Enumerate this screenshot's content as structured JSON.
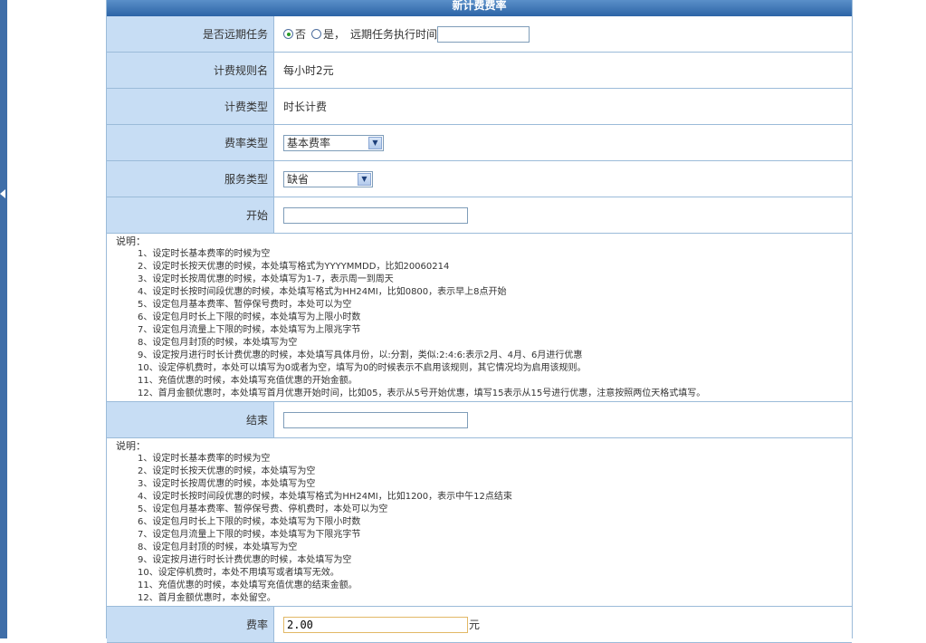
{
  "window": {
    "title": "新计费费率"
  },
  "form": {
    "future_task": {
      "label": "是否远期任务",
      "option_no": "否",
      "option_yes": "是，",
      "exec_time_label": "远期任务执行时间",
      "exec_time_value": ""
    },
    "rule_name": {
      "label": "计费规则名",
      "value": "每小时2元"
    },
    "charge_type": {
      "label": "计费类型",
      "value": "时长计费"
    },
    "rate_type": {
      "label": "费率类型",
      "selected": "基本费率"
    },
    "service_type": {
      "label": "服务类型",
      "selected": "缺省"
    },
    "start": {
      "label": "开始",
      "value": ""
    },
    "end": {
      "label": "结束",
      "value": ""
    },
    "rate": {
      "label": "费率",
      "value": "2.00",
      "unit": "元"
    }
  },
  "start_notes": {
    "heading": "说明：",
    "items": [
      "1、设定时长基本费率的时候为空",
      "2、设定时长按天优惠的时候，本处填写格式为YYYYMMDD，比如20060214",
      "3、设定时长按周优惠的时候，本处填写为1-7，表示周一到周天",
      "4、设定时长按时间段优惠的时候，本处填写格式为HH24MI，比如0800，表示早上8点开始",
      "5、设定包月基本费率、暂停保号费时，本处可以为空",
      "6、设定包月时长上下限的时候，本处填写为上限小时数",
      "7、设定包月流量上下限的时候，本处填写为上限兆字节",
      "8、设定包月封顶的时候，本处填写为空",
      "9、设定按月进行时长计费优惠的时候，本处填写具体月份，以:分割，类似:2:4:6:表示2月、4月、6月进行优惠",
      "10、设定停机费时，本处可以填写为0或者为空，填写为0的时候表示不启用该规则，其它情况均为启用该规则。",
      "11、充值优惠的时候，本处填写充值优惠的开始金额。",
      "12、首月金额优惠时，本处填写首月优惠开始时间，比如05，表示从5号开始优惠，填写15表示从15号进行优惠，注意按照两位天格式填写。"
    ]
  },
  "end_notes": {
    "heading": "说明：",
    "items": [
      "1、设定时长基本费率的时候为空",
      "2、设定时长按天优惠的时候，本处填写为空",
      "3、设定时长按周优惠的时候，本处填写为空",
      "4、设定时长按时间段优惠的时候，本处填写格式为HH24MI，比如1200，表示中午12点结束",
      "5、设定包月基本费率、暂停保号费、停机费时，本处可以为空",
      "6、设定包月时长上下限的时候，本处填写为下限小时数",
      "7、设定包月流量上下限的时候，本处填写为下限兆字节",
      "8、设定包月封顶的时候，本处填写为空",
      "9、设定按月进行时长计费优惠的时候，本处填写为空",
      "10、设定停机费时，本处不用填写或者填写无效。",
      "11、充值优惠的时候，本处填写充值优惠的结束金额。",
      "12、首月金额优惠时，本处留空。"
    ]
  }
}
